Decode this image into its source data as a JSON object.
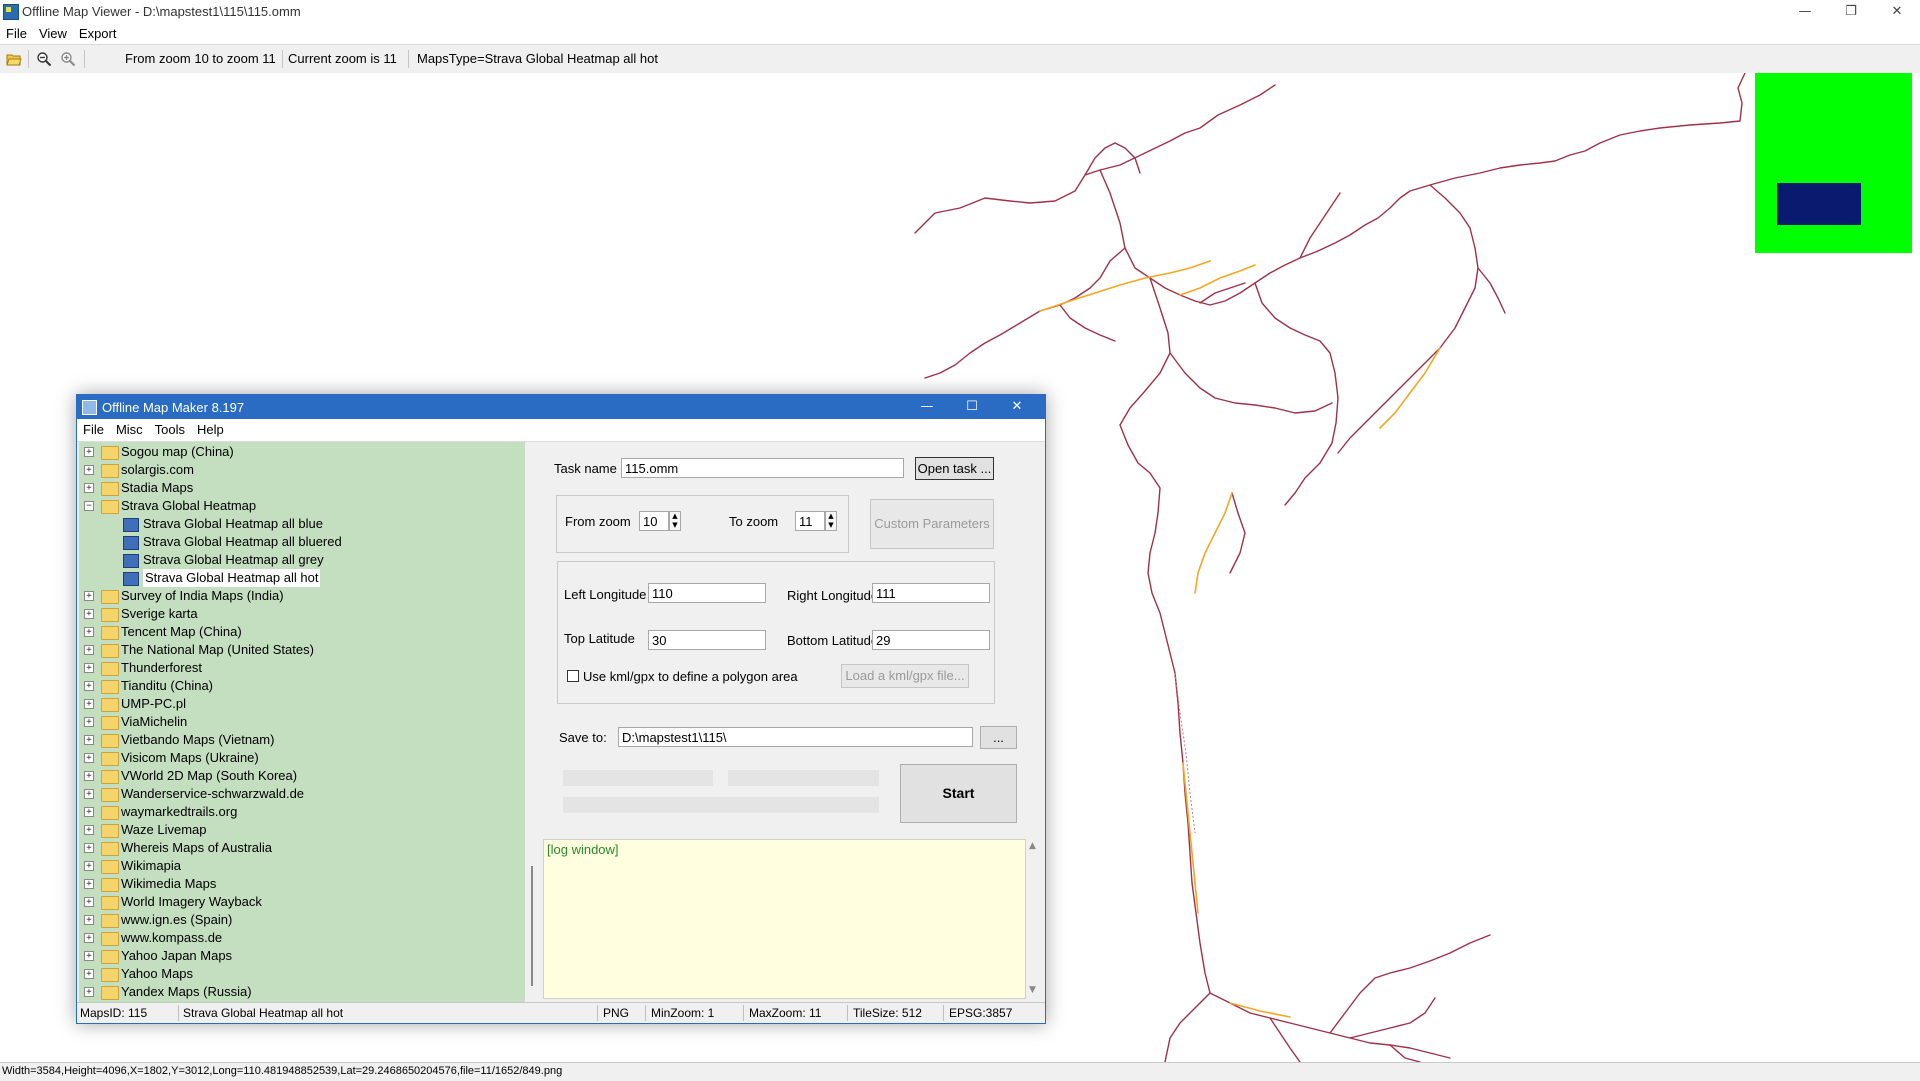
{
  "window": {
    "title": "Offline Map Viewer - D:\\mapstest1\\115\\115.omm",
    "controls": {
      "minimize": "—",
      "restore": "❐",
      "close": "✕"
    }
  },
  "menu": [
    "File",
    "View",
    "Export"
  ],
  "toolbar": {
    "icons": {
      "open": "folder-open-icon",
      "zoom_out": "zoom-out-icon",
      "zoom_in": "zoom-in-icon"
    },
    "zoom_range": "From zoom 10 to zoom 11",
    "current_zoom": "Current zoom is 11",
    "maps_type": "MapsType=Strava Global Heatmap all hot"
  },
  "map": {
    "line_color": "#a0304a",
    "highlight_color": "#f5a623",
    "overview_bg": "#00ff00",
    "overview_viewport": "#0a1a6e"
  },
  "status": "Width=3584,Height=4096,X=1802,Y=3012,Long=110.481948852539,Lat=29.2468650204576,file=11/1652/849.png",
  "dialog": {
    "title": "Offline Map Maker 8.197",
    "controls": {
      "minimize": "—",
      "maximize": "☐",
      "close": "✕"
    },
    "menu": [
      "File",
      "Misc",
      "Tools",
      "Help"
    ],
    "tree": [
      {
        "label": "Sogou map (China)",
        "level": 0,
        "type": "folder",
        "expand": "+"
      },
      {
        "label": "solargis.com",
        "level": 0,
        "type": "folder",
        "expand": "+"
      },
      {
        "label": "Stadia Maps",
        "level": 0,
        "type": "folder",
        "expand": "+"
      },
      {
        "label": "Strava Global Heatmap",
        "level": 0,
        "type": "folder-open",
        "expand": "−"
      },
      {
        "label": "Strava Global Heatmap all blue",
        "level": 1,
        "type": "map"
      },
      {
        "label": "Strava Global Heatmap all bluered",
        "level": 1,
        "type": "map"
      },
      {
        "label": "Strava Global Heatmap all grey",
        "level": 1,
        "type": "map"
      },
      {
        "label": "Strava Global Heatmap all hot",
        "level": 1,
        "type": "map",
        "selected": true
      },
      {
        "label": "Survey of India Maps (India)",
        "level": 0,
        "type": "folder",
        "expand": "+"
      },
      {
        "label": "Sverige karta",
        "level": 0,
        "type": "folder",
        "expand": "+"
      },
      {
        "label": "Tencent Map (China)",
        "level": 0,
        "type": "folder",
        "expand": "+"
      },
      {
        "label": "The National Map (United States)",
        "level": 0,
        "type": "folder",
        "expand": "+"
      },
      {
        "label": "Thunderforest",
        "level": 0,
        "type": "folder",
        "expand": "+"
      },
      {
        "label": "Tianditu (China)",
        "level": 0,
        "type": "folder",
        "expand": "+"
      },
      {
        "label": "UMP-PC.pl",
        "level": 0,
        "type": "folder",
        "expand": "+"
      },
      {
        "label": "ViaMichelin",
        "level": 0,
        "type": "folder",
        "expand": "+"
      },
      {
        "label": "Vietbando Maps (Vietnam)",
        "level": 0,
        "type": "folder",
        "expand": "+"
      },
      {
        "label": "Visicom Maps (Ukraine)",
        "level": 0,
        "type": "folder",
        "expand": "+"
      },
      {
        "label": "VWorld 2D Map (South Korea)",
        "level": 0,
        "type": "folder",
        "expand": "+"
      },
      {
        "label": "Wanderservice-schwarzwald.de",
        "level": 0,
        "type": "folder",
        "expand": "+"
      },
      {
        "label": "waymarkedtrails.org",
        "level": 0,
        "type": "folder",
        "expand": "+"
      },
      {
        "label": "Waze Livemap",
        "level": 0,
        "type": "folder",
        "expand": "+"
      },
      {
        "label": "Whereis Maps of Australia",
        "level": 0,
        "type": "folder",
        "expand": "+"
      },
      {
        "label": "Wikimapia",
        "level": 0,
        "type": "folder",
        "expand": "+"
      },
      {
        "label": "Wikimedia Maps",
        "level": 0,
        "type": "folder",
        "expand": "+"
      },
      {
        "label": "World Imagery Wayback",
        "level": 0,
        "type": "folder",
        "expand": "+"
      },
      {
        "label": "www.ign.es (Spain)",
        "level": 0,
        "type": "folder",
        "expand": "+"
      },
      {
        "label": "www.kompass.de",
        "level": 0,
        "type": "folder",
        "expand": "+"
      },
      {
        "label": "Yahoo Japan Maps",
        "level": 0,
        "type": "folder",
        "expand": "+"
      },
      {
        "label": "Yahoo Maps",
        "level": 0,
        "type": "folder",
        "expand": "+"
      },
      {
        "label": "Yandex Maps (Russia)",
        "level": 0,
        "type": "folder",
        "expand": "+"
      }
    ],
    "task": {
      "label": "Task name",
      "value": "115.omm",
      "open_button": "Open task ..."
    },
    "zoom": {
      "from_label": "From zoom",
      "from_value": "10",
      "to_label": "To zoom",
      "to_value": "11",
      "custom_button": "Custom Parameters"
    },
    "coords": {
      "left_label": "Left Longitude",
      "left_value": "110",
      "right_label": "Right Longitude",
      "right_value": "111",
      "top_label": "Top Latitude",
      "top_value": "30",
      "bottom_label": "Bottom Latitude",
      "bottom_value": "29",
      "kml_checkbox": "Use kml/gpx to define a polygon area",
      "kml_button": "Load a kml/gpx file..."
    },
    "save": {
      "label": "Save to:",
      "value": "D:\\mapstest1\\115\\",
      "browse": "..."
    },
    "start_button": "Start",
    "log": "[log window]",
    "statusbar": {
      "maps_id": "MapsID: 115",
      "maps_name": "Strava Global Heatmap all hot",
      "format": "PNG",
      "min_zoom": "MinZoom: 1",
      "max_zoom": "MaxZoom: 11",
      "tile_size": "TileSize: 512",
      "epsg": "EPSG:3857"
    }
  }
}
